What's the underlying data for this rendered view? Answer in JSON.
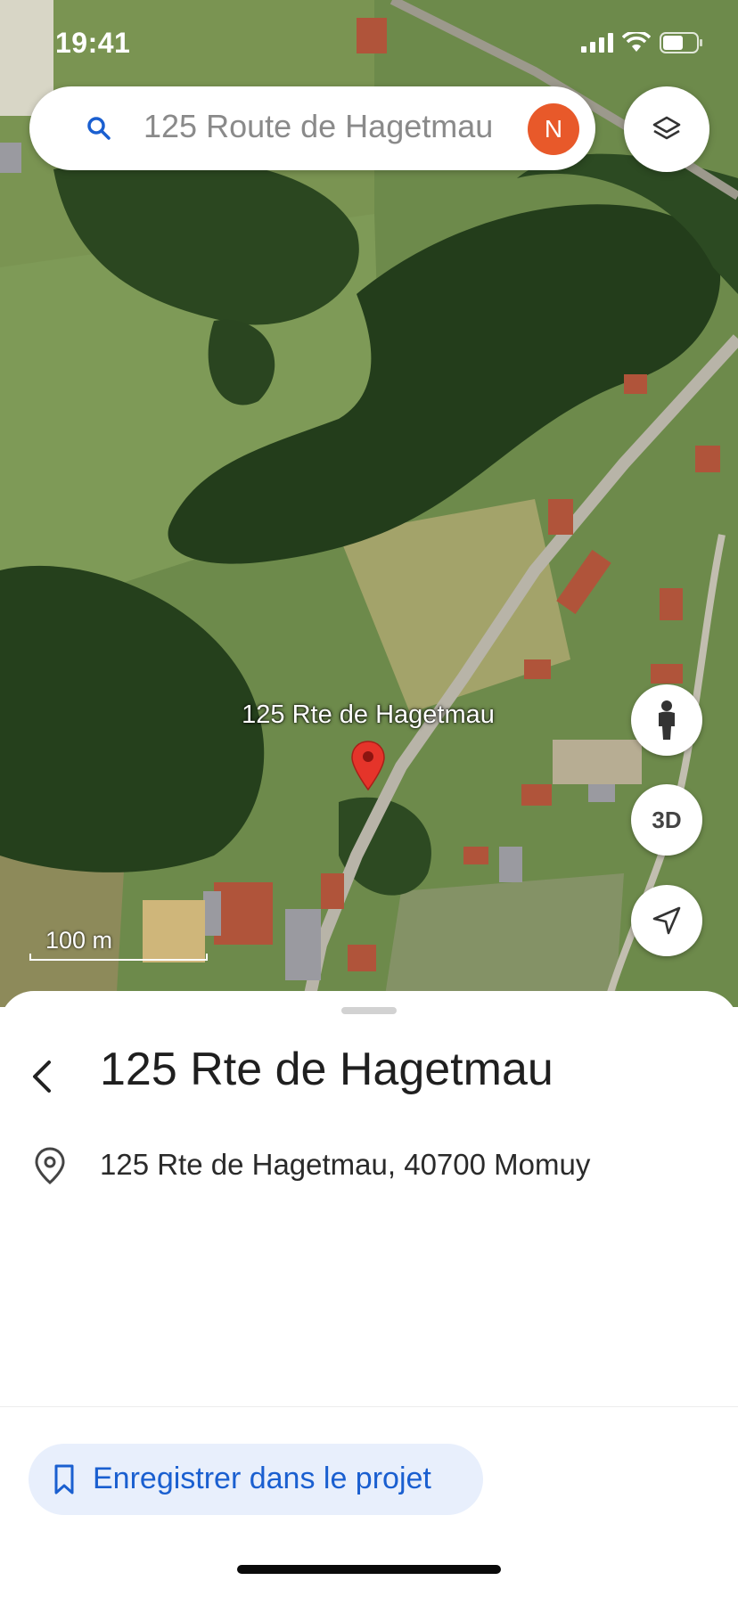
{
  "status_bar": {
    "time": "19:41"
  },
  "search": {
    "query": "125 Route de Hagetmau",
    "avatar_initial": "N",
    "avatar_color": "#e8592a"
  },
  "map": {
    "pin_label": "125 Rte de Hagetmau",
    "pin_color": "#e5342a",
    "scale_label": "100 m",
    "fab_3d_label": "3D",
    "icons": [
      "search-icon",
      "layers-icon",
      "pegman-icon",
      "navigate-arrow-icon",
      "location-pin-icon"
    ]
  },
  "place": {
    "title": "125 Rte de Hagetmau",
    "address": "125 Rte de Hagetmau, 40700 Momuy"
  },
  "actions": {
    "save_label": "Enregistrer dans le projet",
    "accent_color": "#1a5fd0"
  }
}
